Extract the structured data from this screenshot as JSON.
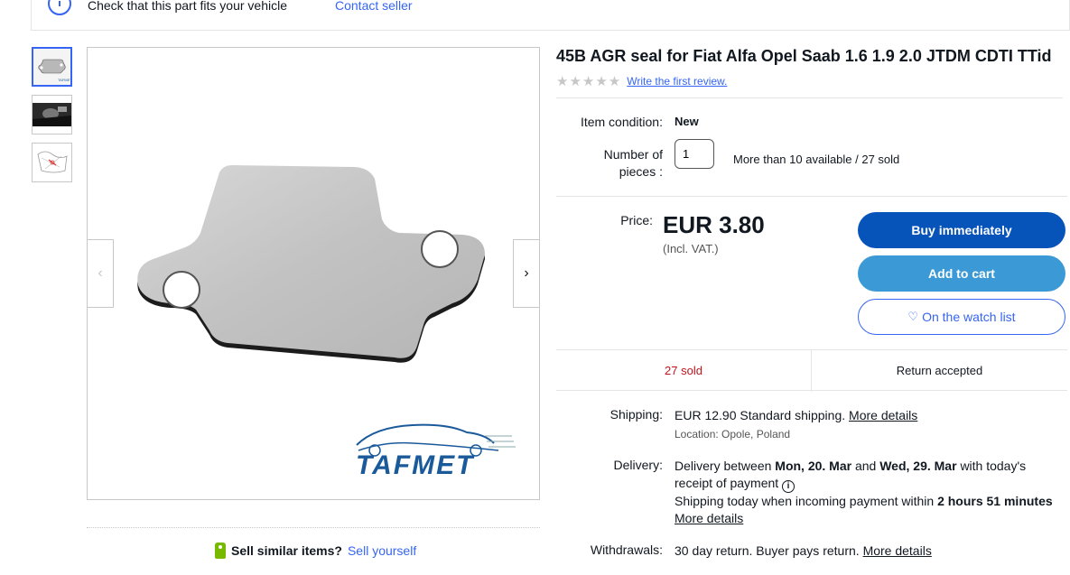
{
  "fitment": {
    "text": "Check that this part fits your vehicle",
    "contact_link": "Contact seller"
  },
  "gallery": {
    "thumbnails": [
      "product-photo",
      "installed-photo",
      "diagram-photo"
    ],
    "brand_logo": "TAFMET"
  },
  "sell": {
    "prompt": "Sell similar items?",
    "link": "Sell yourself"
  },
  "product": {
    "title": "45B AGR seal for Fiat Alfa Opel Saab 1.6 1.9 2.0 JTDM CDTI TTid",
    "review_link": "Write the first review.",
    "condition_label": "Item condition:",
    "condition_value": "New",
    "qty_label": "Number of pieces :",
    "qty_value": "1",
    "availability": "More than 10 available / 27 sold",
    "price_label": "Price:",
    "price": "EUR 3.80",
    "vat": "(Incl. VAT.)",
    "rating_stars": 0
  },
  "actions": {
    "buy": "Buy immediately",
    "cart": "Add to cart",
    "watch": "On the watch list"
  },
  "stats": {
    "sold": "27 sold",
    "returns": "Return accepted"
  },
  "shipping": {
    "label": "Shipping:",
    "price": "EUR 12.90",
    "method": "Standard shipping.",
    "more": "More details",
    "location": "Location: Opole, Poland"
  },
  "delivery": {
    "label": "Delivery:",
    "prefix": "Delivery between",
    "date_from": "Mon, 20. Mar",
    "and": "and",
    "date_to": "Wed, 29. Mar",
    "suffix": "with today's receipt of payment",
    "line2_prefix": "Shipping today when incoming payment within",
    "time_left": "2 hours 51 minutes",
    "more": "More details"
  },
  "withdrawals": {
    "label": "Withdrawals:",
    "text": "30 day return. Buyer pays return.",
    "more": "More details"
  },
  "colors": {
    "accent": "#3665f3",
    "buy_button": "#0654ba",
    "cart_button": "#3b9ad5",
    "sold_text": "#c0151d"
  }
}
